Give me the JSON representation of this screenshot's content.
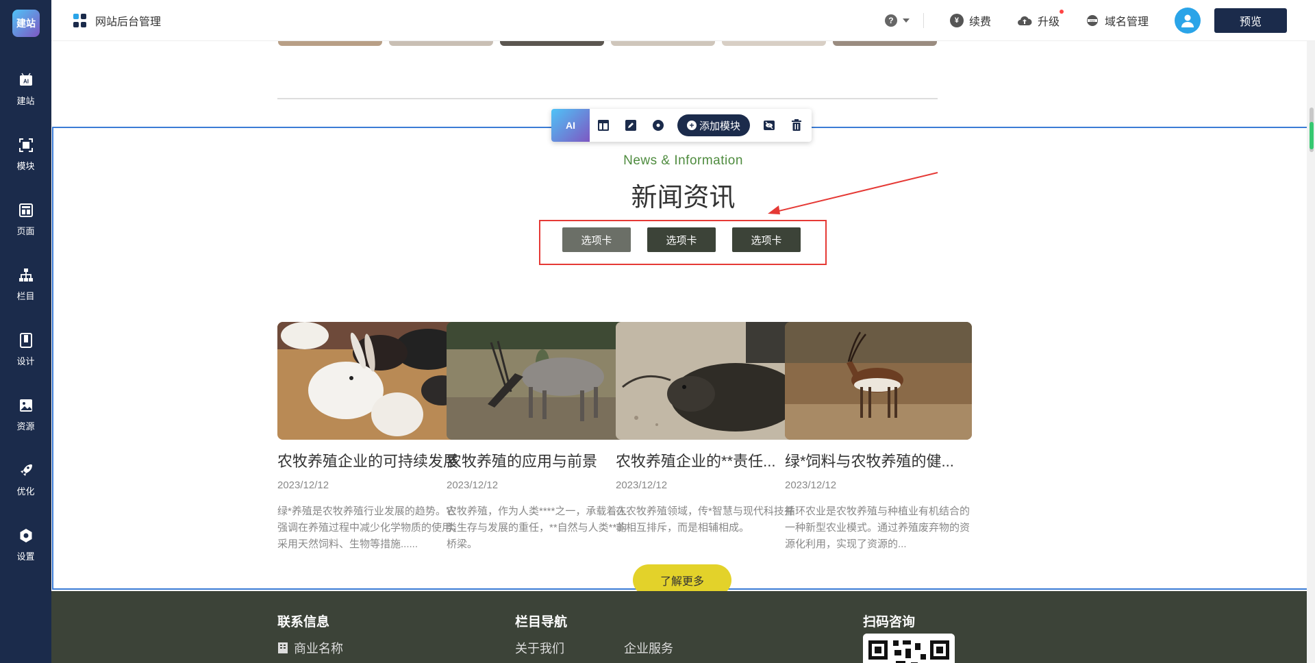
{
  "sidebar": {
    "logo_text": "建站",
    "items": [
      {
        "label": "建站",
        "icon": "ai-icon"
      },
      {
        "label": "模块",
        "icon": "module-icon"
      },
      {
        "label": "页面",
        "icon": "page-icon"
      },
      {
        "label": "栏目",
        "icon": "sitemap-icon"
      },
      {
        "label": "设计",
        "icon": "design-icon"
      },
      {
        "label": "资源",
        "icon": "image-icon"
      },
      {
        "label": "优化",
        "icon": "rocket-icon"
      },
      {
        "label": "设置",
        "icon": "gear-icon"
      }
    ]
  },
  "header": {
    "title": "网站后台管理",
    "help": "?",
    "renew": "续费",
    "upgrade": "升级",
    "domain": "域名管理",
    "preview": "预览"
  },
  "toolbar": {
    "ai_label": "AI",
    "add_module": "添加模块"
  },
  "section": {
    "subtitle_en": "News & Information",
    "title_cn": "新闻资讯",
    "tabs": [
      "选项卡",
      "选项卡",
      "选项卡"
    ],
    "more_button": "了解更多"
  },
  "news": [
    {
      "title": "农牧养殖企业的可持续发展",
      "date": "2023/12/12",
      "desc": "绿*养殖是农牧养殖行业发展的趋势。它强调在养殖过程中减少化学物质的使用，采用天然饲料、生物等措施......"
    },
    {
      "title": "农牧养殖的应用与前景",
      "date": "2023/12/12",
      "desc": "农牧养殖，作为人类****之一，承载着人类生存与发展的重任，**自然与人类**的桥梁。"
    },
    {
      "title": "农牧养殖企业的**责任...",
      "date": "2023/12/12",
      "desc": "在农牧养殖领域，传*智慧与现代科技并非相互排斥，而是相辅相成。"
    },
    {
      "title": "绿*饲料与农牧养殖的健...",
      "date": "2023/12/12",
      "desc": "循环农业是农牧养殖与种植业有机结合的一种新型农业模式。通过养殖废弃物的资源化利用，实现了资源的..."
    }
  ],
  "footer": {
    "contact_head": "联系信息",
    "company_name": "商业名称",
    "nav_head": "栏目导航",
    "nav_links": [
      "关于我们",
      "企业服务"
    ],
    "qr_head": "扫码咨询"
  },
  "colors": {
    "sidebar_bg": "#1b2b4b",
    "selection_border": "#3a7bd5",
    "accent_green": "#4e8b3e",
    "more_button": "#e3d22a",
    "footer_bg": "#3c4338",
    "highlight_red": "#e53935"
  }
}
